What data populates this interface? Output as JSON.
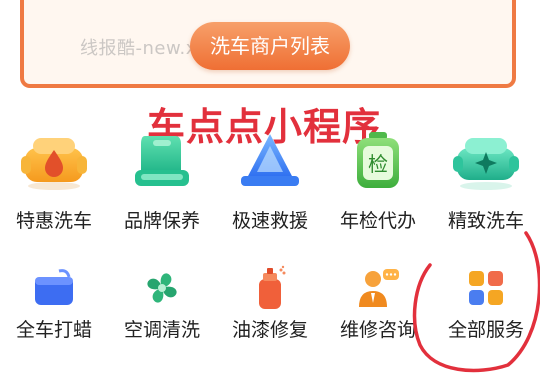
{
  "header": {
    "watermark": "线报酷-new.xianbao.fun",
    "merchant_button_label": "洗车商户列表"
  },
  "overlay_title": "车点点小程序",
  "services_row1": [
    {
      "label": "特惠洗车",
      "icon": "car-wash-drop-icon"
    },
    {
      "label": "品牌保养",
      "icon": "car-seat-icon"
    },
    {
      "label": "极速救援",
      "icon": "warning-triangle-icon"
    },
    {
      "label": "年检代办",
      "icon": "inspection-tag-icon"
    },
    {
      "label": "精致洗车",
      "icon": "car-sparkle-icon"
    }
  ],
  "services_row2": [
    {
      "label": "全车打蜡",
      "icon": "wax-card-icon"
    },
    {
      "label": "空调清洗",
      "icon": "fan-icon"
    },
    {
      "label": "油漆修复",
      "icon": "spray-paint-icon"
    },
    {
      "label": "维修咨询",
      "icon": "consultant-icon"
    },
    {
      "label": "全部服务",
      "icon": "grid-apps-icon"
    }
  ],
  "colors": {
    "accent_orange": "#ef7a43",
    "overlay_red": "#e2303c",
    "label_text": "#222222"
  }
}
